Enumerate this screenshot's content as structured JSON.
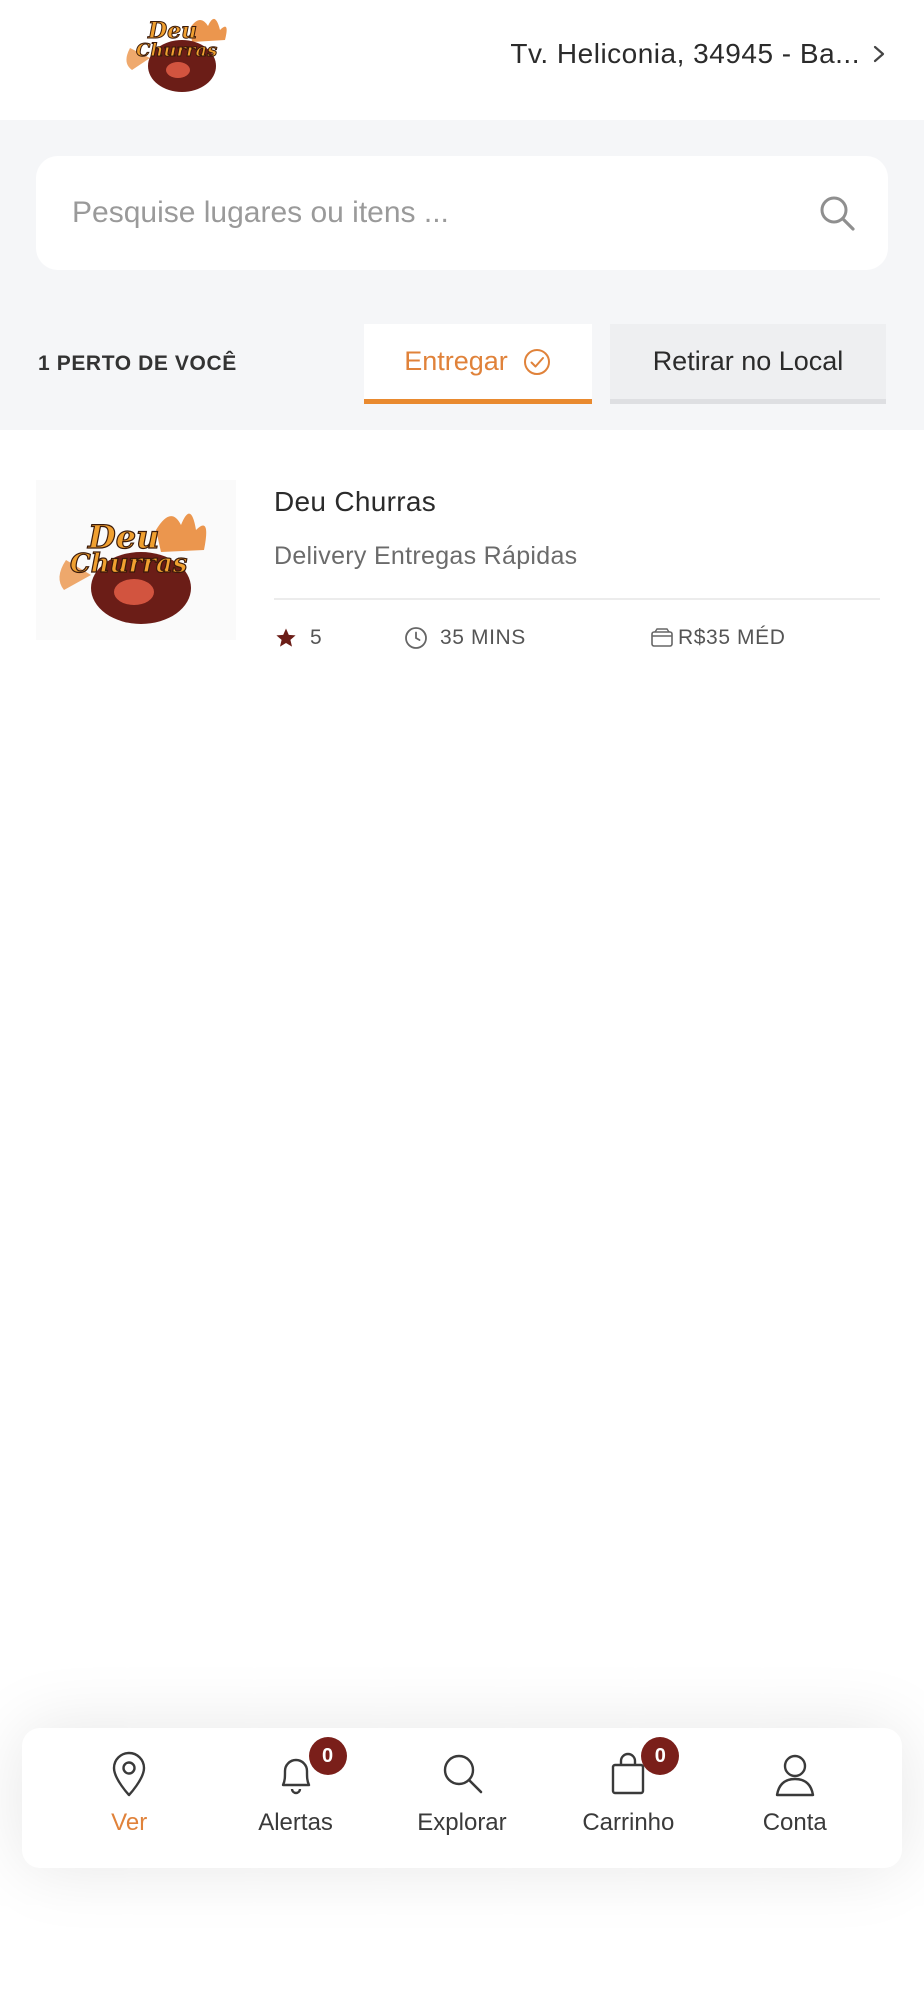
{
  "header": {
    "address": "Tv. Heliconia, 34945 - Ba...",
    "logo_text_line1": "Deu",
    "logo_text_line2": "Churras"
  },
  "search": {
    "placeholder": "Pesquise lugares ou itens ..."
  },
  "filters": {
    "nearby_count_label": "1 PERTO DE VOCÊ",
    "deliver_label": "Entregar",
    "pickup_label": "Retirar no Local"
  },
  "stores": [
    {
      "name": "Deu Churras",
      "description": "Delivery Entregas Rápidas",
      "rating": "5",
      "time": "35 MINS",
      "price": "R$35 MÉD"
    }
  ],
  "bottom_nav": {
    "items": [
      {
        "label": "Ver",
        "icon": "map-pin-icon"
      },
      {
        "label": "Alertas",
        "icon": "bell-icon",
        "badge": "0"
      },
      {
        "label": "Explorar",
        "icon": "search-icon"
      },
      {
        "label": "Carrinho",
        "icon": "shopping-bag-icon",
        "badge": "0"
      },
      {
        "label": "Conta",
        "icon": "user-icon"
      }
    ]
  },
  "colors": {
    "accent": "#e0823a",
    "badge": "#7a1f1a",
    "panel_bg": "#f5f6f8"
  }
}
